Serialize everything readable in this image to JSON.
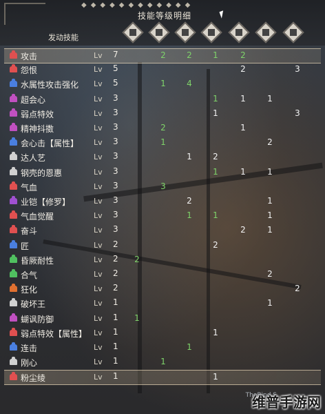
{
  "header": {
    "title": "技能等级明细",
    "section": "发动技能",
    "column_icons": [
      "weapon-icon",
      "head-armor-icon",
      "chest-armor-icon",
      "arm-armor-icon",
      "waist-armor-icon",
      "leg-armor-icon",
      "charm-icon"
    ]
  },
  "lv_label": "Lv",
  "skills": [
    {
      "name": "攻击",
      "level": "7",
      "color": "#e05050",
      "cells": [
        "",
        "2",
        "2",
        "1",
        "2",
        "",
        ""
      ],
      "highlight": true
    },
    {
      "name": "怨恨",
      "level": "5",
      "color": "#e05050",
      "cells": [
        "",
        "",
        "",
        "",
        "2",
        "",
        "3"
      ]
    },
    {
      "name": "水属性攻击强化",
      "level": "5",
      "color": "#4a7fe0",
      "cells": [
        "",
        "1",
        "4",
        "",
        "",
        "",
        ""
      ]
    },
    {
      "name": "超会心",
      "level": "3",
      "color": "#c050c0",
      "cells": [
        "",
        "",
        "",
        "1",
        "1",
        "1",
        ""
      ]
    },
    {
      "name": "弱点特效",
      "level": "3",
      "color": "#c050c0",
      "cells": [
        "",
        "",
        "",
        "1",
        "",
        "",
        "3"
      ]
    },
    {
      "name": "精神抖擞",
      "level": "3",
      "color": "#c050c0",
      "cells": [
        "",
        "2",
        "",
        "",
        "1",
        "",
        ""
      ]
    },
    {
      "name": "会心击【属性】",
      "level": "3",
      "color": "#4a7fe0",
      "cells": [
        "",
        "1",
        "",
        "",
        "",
        "2",
        ""
      ]
    },
    {
      "name": "达人艺",
      "level": "3",
      "color": "#d0d0d0",
      "cells": [
        "",
        "",
        "1",
        "2",
        "",
        "",
        ""
      ]
    },
    {
      "name": "钢壳的恩惠",
      "level": "3",
      "color": "#d0d0d0",
      "cells": [
        "",
        "",
        "",
        "1",
        "1",
        "1",
        ""
      ]
    },
    {
      "name": "气血",
      "level": "3",
      "color": "#e05050",
      "cells": [
        "",
        "3",
        "",
        "",
        "",
        "",
        ""
      ]
    },
    {
      "name": "业铠【修罗】",
      "level": "3",
      "color": "#a050d0",
      "cells": [
        "",
        "",
        "2",
        "",
        "",
        "1",
        ""
      ]
    },
    {
      "name": "气血觉醒",
      "level": "3",
      "color": "#e05050",
      "cells": [
        "",
        "",
        "1",
        "1",
        "",
        "1",
        ""
      ]
    },
    {
      "name": "奋斗",
      "level": "3",
      "color": "#e05050",
      "cells": [
        "",
        "",
        "",
        "",
        "2",
        "1",
        ""
      ]
    },
    {
      "name": "匠",
      "level": "2",
      "color": "#4a7fe0",
      "cells": [
        "",
        "",
        "",
        "2",
        "",
        "",
        ""
      ]
    },
    {
      "name": "昏厥耐性",
      "level": "2",
      "color": "#50c060",
      "cells": [
        "2",
        "",
        "",
        "",
        "",
        "",
        ""
      ]
    },
    {
      "name": "合气",
      "level": "2",
      "color": "#50c060",
      "cells": [
        "",
        "",
        "",
        "",
        "",
        "2",
        ""
      ]
    },
    {
      "name": "狂化",
      "level": "2",
      "color": "#e07030",
      "cells": [
        "",
        "",
        "",
        "",
        "",
        "",
        "2"
      ]
    },
    {
      "name": "破坏王",
      "level": "1",
      "color": "#d0d0d0",
      "cells": [
        "",
        "",
        "",
        "",
        "",
        "1",
        ""
      ]
    },
    {
      "name": "蝴讽防御",
      "level": "1",
      "color": "#c050c0",
      "cells": [
        "1",
        "",
        "",
        "",
        "",
        "",
        ""
      ]
    },
    {
      "name": "弱点特效【属性】",
      "level": "1",
      "color": "#e05050",
      "cells": [
        "",
        "",
        "",
        "1",
        "",
        "",
        ""
      ]
    },
    {
      "name": "连击",
      "level": "1",
      "color": "#4a7fe0",
      "cells": [
        "",
        "",
        "1",
        "",
        "",
        "",
        ""
      ]
    },
    {
      "name": "刚心",
      "level": "1",
      "color": "#d0d0d0",
      "cells": [
        "",
        "1",
        "",
        "",
        "",
        "",
        ""
      ]
    },
    {
      "name": "粉尘绫",
      "level": "1",
      "color": "#e05050",
      "cells": [
        "",
        "",
        "",
        "1",
        "",
        "",
        ""
      ],
      "highlight": true
    }
  ],
  "watermark": {
    "main": "维普手游网",
    "small": "TheBind.S"
  }
}
